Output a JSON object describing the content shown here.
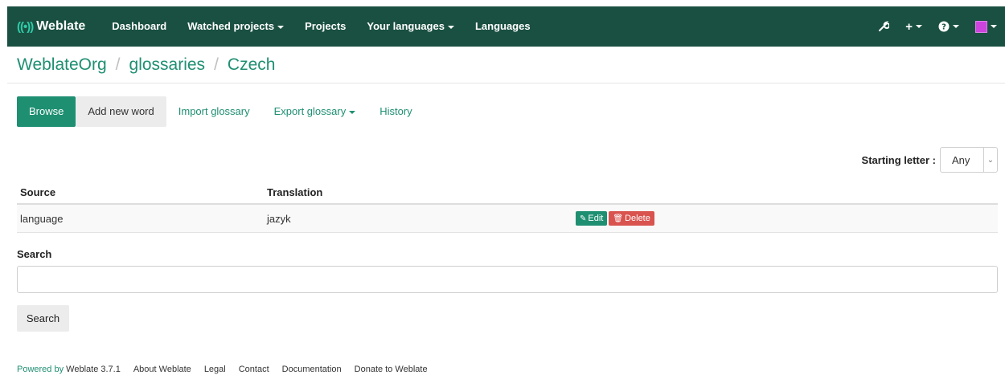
{
  "nav": {
    "brand": "Weblate",
    "brand_mark": "()",
    "items": [
      "Dashboard",
      "Watched projects",
      "Projects",
      "Your languages",
      "Languages"
    ],
    "icons": {
      "tools": "wrench-icon",
      "add": "plus-icon",
      "help": "question-icon",
      "user": "avatar"
    }
  },
  "breadcrumb": {
    "org": "WeblateOrg",
    "project": "glossaries",
    "language": "Czech",
    "separator": "/"
  },
  "tabs": {
    "browse": "Browse",
    "add_word": "Add new word",
    "import": "Import glossary",
    "export": "Export glossary",
    "history": "History"
  },
  "filter": {
    "label": "Starting letter :",
    "value": "Any"
  },
  "table": {
    "headers": {
      "source": "Source",
      "translation": "Translation"
    },
    "rows": [
      {
        "source": "language",
        "translation": "jazyk",
        "edit": "Edit",
        "delete": "Delete"
      }
    ]
  },
  "search": {
    "label": "Search",
    "placeholder": "",
    "button": "Search"
  },
  "footer": {
    "powered_by": "Powered by",
    "version": "Weblate 3.7.1",
    "links": [
      "About Weblate",
      "Legal",
      "Contact",
      "Documentation",
      "Donate to Weblate"
    ]
  },
  "colors": {
    "navbar": "#1a5041",
    "accent": "#1f8f72",
    "danger": "#d9534f"
  }
}
